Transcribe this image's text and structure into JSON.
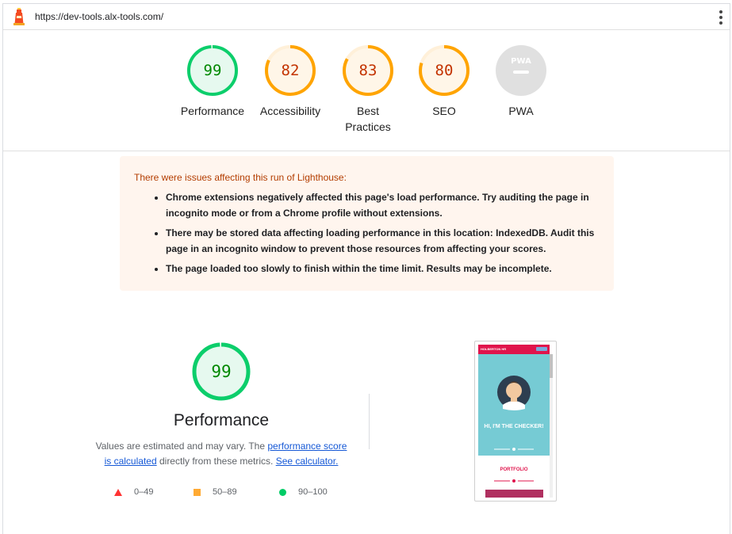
{
  "url_bar": {
    "url": "https://dev-tools.alx-tools.com/"
  },
  "gauges": [
    {
      "label": "Performance",
      "score": "99",
      "value": 0.99,
      "status": "pass"
    },
    {
      "label": "Accessibility",
      "score": "82",
      "value": 0.82,
      "status": "average"
    },
    {
      "label": "Best Practices",
      "label_lines": [
        "Best",
        "Practices"
      ],
      "score": "83",
      "value": 0.83,
      "status": "average"
    },
    {
      "label": "SEO",
      "score": "80",
      "value": 0.8,
      "status": "average"
    },
    {
      "label": "PWA",
      "score": "",
      "badge": "PWA",
      "status": "na"
    }
  ],
  "colors": {
    "pass": "#0cce6b",
    "pass_text": "#008800",
    "pass_bg": "#e6f9ef",
    "average": "#ffa400",
    "average_text": "#c33300",
    "average_bg": "#fff6e8",
    "na": "#e0e0e0",
    "fail": "#ff3333",
    "link": "#1558d6"
  },
  "warnings": {
    "title": "There were issues affecting this run of Lighthouse:",
    "items": [
      "Chrome extensions negatively affected this page's load performance. Try auditing the page in incognito mode or from a Chrome profile without extensions.",
      "There may be stored data affecting loading performance in this location: IndexedDB. Audit this page in an incognito window to prevent those resources from affecting your scores.",
      "The page loaded too slowly to finish within the time limit. Results may be incomplete."
    ]
  },
  "performance": {
    "score": "99",
    "value": 0.99,
    "title": "Performance",
    "desc_prefix": "Values are estimated and may vary. The ",
    "link_score": "performance score",
    "link_calculated": "is calculated",
    "desc_middle": " directly from these metrics. ",
    "link_calculator": "See calculator."
  },
  "legend": [
    {
      "range": "0–49",
      "shape": "triangle"
    },
    {
      "range": "50–89",
      "shape": "square"
    },
    {
      "range": "90–100",
      "shape": "circle"
    }
  ],
  "screenshot": {
    "nav_title": "HOLBERTON HR",
    "hero_text": "HI, I'M THE CHECKER!",
    "portfolio": "PORTFOLIO"
  }
}
